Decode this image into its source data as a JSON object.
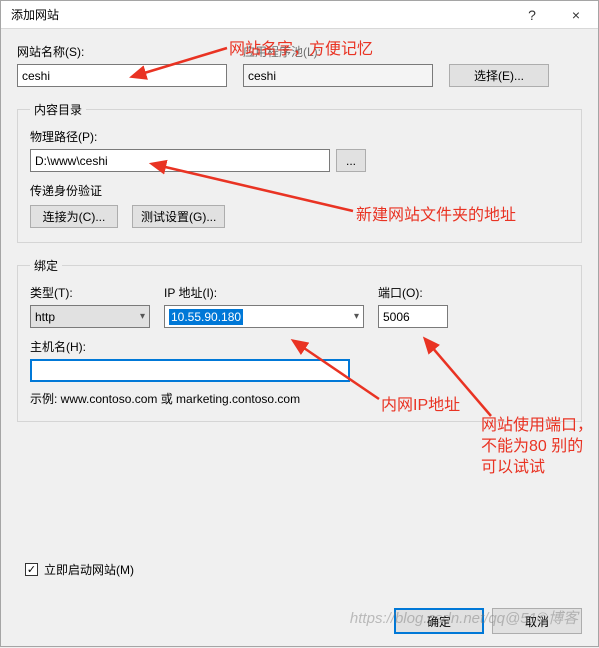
{
  "titlebar": {
    "title": "添加网站",
    "help": "?",
    "close": "×"
  },
  "siteName": {
    "label": "网站名称(S):",
    "value": "ceshi"
  },
  "appPool": {
    "label": "应用程序池(L):",
    "value": "ceshi",
    "selectBtn": "选择(E)..."
  },
  "contentGroup": {
    "legend": "内容目录",
    "physPath": {
      "label": "物理路径(P):",
      "value": "D:\\www\\ceshi",
      "browse": "..."
    },
    "passThrough": "传递身份验证",
    "connectAs": "连接为(C)...",
    "testSettings": "测试设置(G)..."
  },
  "bindingGroup": {
    "legend": "绑定",
    "type": {
      "label": "类型(T):",
      "value": "http"
    },
    "ip": {
      "label": "IP 地址(I):",
      "value": "10.55.90.180"
    },
    "port": {
      "label": "端口(O):",
      "value": "5006"
    },
    "hostname": {
      "label": "主机名(H):",
      "value": ""
    },
    "example": "示例: www.contoso.com 或 marketing.contoso.com"
  },
  "startImmediately": {
    "label": "立即启动网站(M)",
    "checked": "✓"
  },
  "buttons": {
    "ok": "确定",
    "cancel": "取消"
  },
  "annotations": {
    "a1": "网站名字，方便记忆",
    "a2": "新建网站文件夹的地址",
    "a3": "内网IP地址",
    "a4": "网站使用端口，\n不能为80 别的\n可以试试"
  },
  "watermark": "https://blog.csdn.net/qq@51©博客"
}
